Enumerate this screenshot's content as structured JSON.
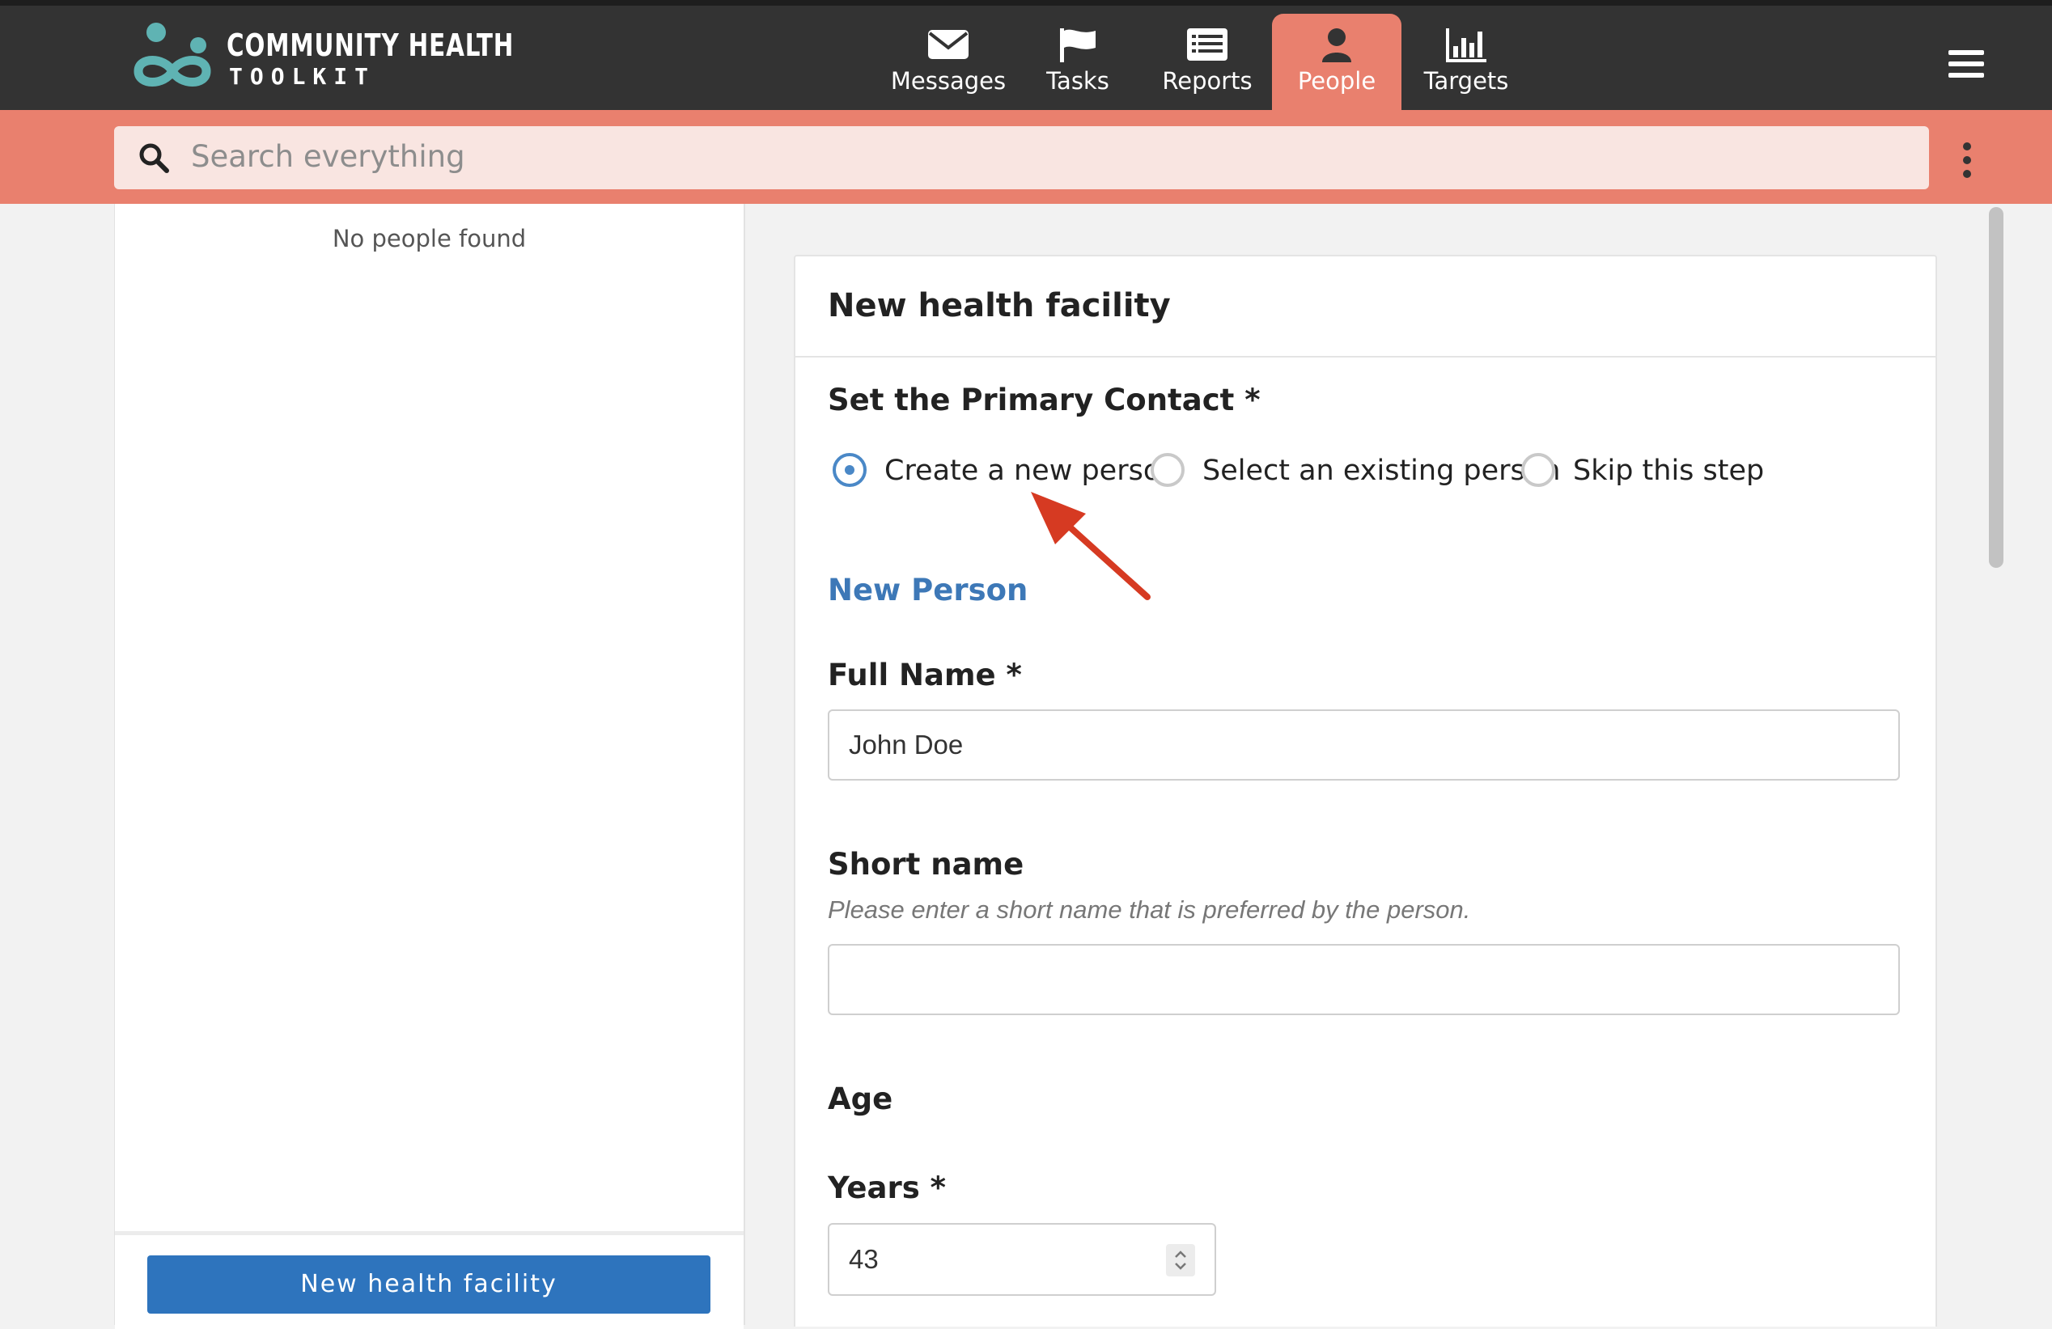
{
  "header": {
    "logo_line1": "COMMUNITY HEALTH",
    "logo_line2": "TOOLKIT",
    "tabs": [
      {
        "label": "Messages",
        "icon": "envelope-icon",
        "active": false
      },
      {
        "label": "Tasks",
        "icon": "flag-icon",
        "active": false
      },
      {
        "label": "Reports",
        "icon": "list-icon",
        "active": false
      },
      {
        "label": "People",
        "icon": "person-icon",
        "active": true
      },
      {
        "label": "Targets",
        "icon": "bar-chart-icon",
        "active": false
      }
    ],
    "menu_icon": "hamburger-menu-icon"
  },
  "search": {
    "placeholder": "Search everything",
    "icon": "search-icon",
    "more_icon": "vertical-dots-icon"
  },
  "left_panel": {
    "empty_message": "No people found",
    "new_button_label": "New health facility"
  },
  "form": {
    "title": "New health facility",
    "primary_contact": {
      "label": "Set the Primary Contact *",
      "options": [
        {
          "label": "Create a new person",
          "selected": true
        },
        {
          "label": "Select an existing person",
          "selected": false
        },
        {
          "label": "Skip this step",
          "selected": false
        }
      ]
    },
    "section_title": "New Person",
    "full_name": {
      "label": "Full Name *",
      "value": "John Doe"
    },
    "short_name": {
      "label": "Short name",
      "hint": "Please enter a short name that is preferred by the person.",
      "value": ""
    },
    "age_label": "Age",
    "years": {
      "label": "Years *",
      "value": "43"
    }
  },
  "colors": {
    "topbar": "#333333",
    "accent": "#e9806e",
    "search_bg": "#f9e5e1",
    "primary_button": "#2e74bd",
    "link_blue": "#3d78b7",
    "annotation_arrow": "#d63a22"
  }
}
